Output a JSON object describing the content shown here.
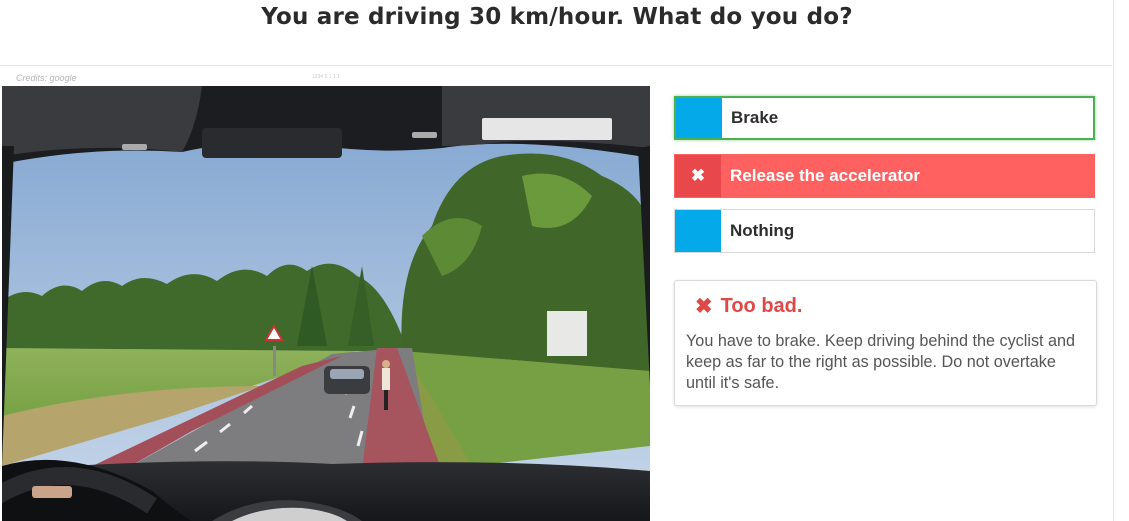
{
  "question": {
    "title": "You are driving 30 km/hour. What do you do?"
  },
  "image": {
    "credits": "Credits: google",
    "id_text": "1234 5 1 1 1"
  },
  "answers": [
    {
      "label": "Brake",
      "state": "correct-selected"
    },
    {
      "label": "Release the accelerator",
      "state": "wrong",
      "icon": "✖"
    },
    {
      "label": "Nothing",
      "state": "neutral"
    }
  ],
  "feedback": {
    "icon": "✖",
    "title": "Too bad.",
    "message": "You have to brake. Keep driving behind the cyclist and keep as far to the right as possible. Do not overtake until it's safe."
  },
  "colors": {
    "answer_swatch": "#03a9e8",
    "wrong": "#ff6161",
    "correct_border": "#4caf50",
    "feedback_red": "#e04848"
  }
}
